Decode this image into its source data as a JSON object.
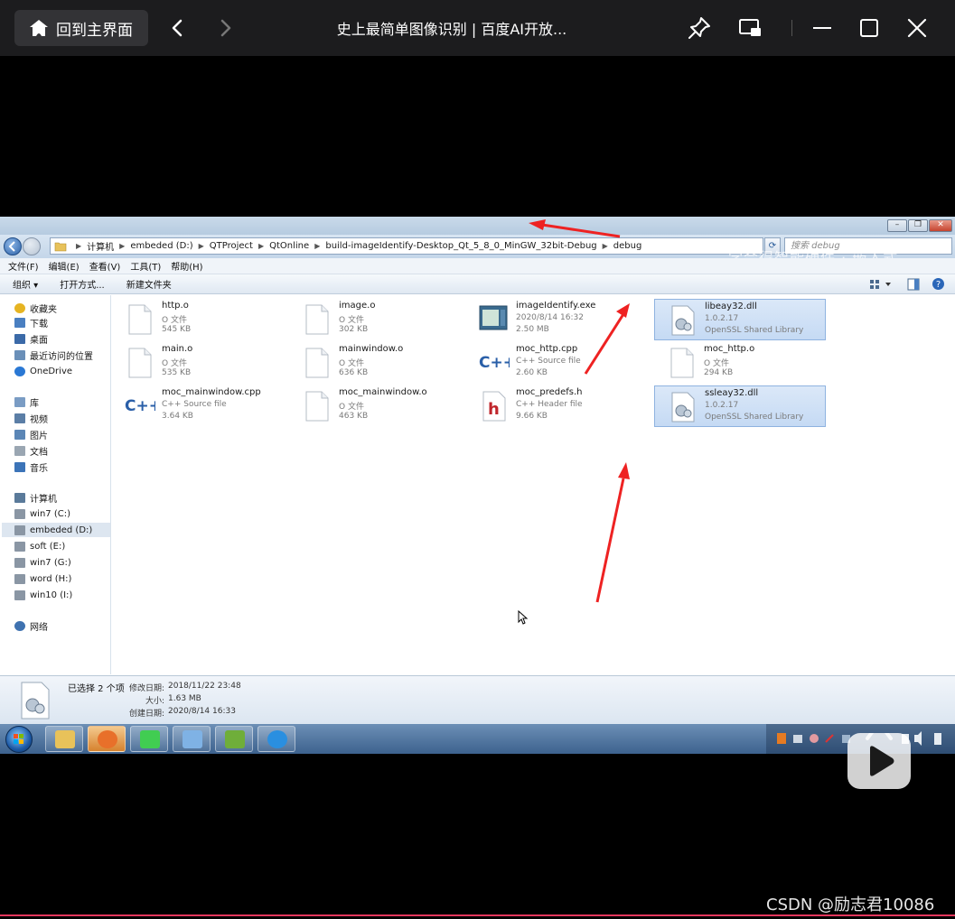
{
  "player": {
    "home_label": "回到主界面",
    "title": "史上最简单图像识别 | 百度AI开放...",
    "progress": 1.0
  },
  "explorer": {
    "breadcrumb": [
      "计算机",
      "embeded (D:)",
      "QTProject",
      "QtOnline",
      "build-imageIdentify-Desktop_Qt_5_8_0_MinGW_32bit-Debug",
      "debug"
    ],
    "search_placeholder": "搜索 debug",
    "watermark": "学会得智能硬件 · 嵌入式",
    "menu": [
      "文件(F)",
      "编辑(E)",
      "查看(V)",
      "工具(T)",
      "帮助(H)"
    ],
    "commands": [
      "组织 ▾",
      "打开方式...",
      "新建文件夹"
    ],
    "nav": [
      {
        "label": "收藏夹",
        "icon": "star-icon",
        "color": "#e6b422"
      },
      {
        "label": "下载",
        "icon": "download-folder-icon",
        "color": "#4a7fc1"
      },
      {
        "label": "桌面",
        "icon": "desktop-icon",
        "color": "#3b6aa8"
      },
      {
        "label": "最近访问的位置",
        "icon": "recent-places-icon",
        "color": "#6a8fb8"
      },
      {
        "label": "OneDrive",
        "icon": "cloud-icon",
        "color": "#2a78d4"
      },
      {
        "label": "库",
        "icon": "library-icon",
        "color": "#7a9cc4"
      },
      {
        "label": "视频",
        "icon": "video-library-icon",
        "color": "#5b7ea6"
      },
      {
        "label": "图片",
        "icon": "pictures-library-icon",
        "color": "#5b86b6"
      },
      {
        "label": "文档",
        "icon": "documents-library-icon",
        "color": "#9aa6b2"
      },
      {
        "label": "音乐",
        "icon": "music-library-icon",
        "color": "#3c74b8"
      },
      {
        "label": "计算机",
        "icon": "computer-icon",
        "color": "#5a7a9a"
      },
      {
        "label": "win7 (C:)",
        "icon": "drive-icon",
        "color": "#8a96a4"
      },
      {
        "label": "embeded (D:)",
        "icon": "drive-icon",
        "color": "#8a96a4",
        "selected": true
      },
      {
        "label": "soft (E:)",
        "icon": "drive-icon",
        "color": "#8a96a4"
      },
      {
        "label": "win7 (G:)",
        "icon": "drive-icon",
        "color": "#8a96a4"
      },
      {
        "label": "word (H:)",
        "icon": "drive-icon",
        "color": "#8a96a4"
      },
      {
        "label": "win10 (I:)",
        "icon": "drive-icon",
        "color": "#8a96a4"
      },
      {
        "label": "网络",
        "icon": "network-icon",
        "color": "#3f72b0"
      }
    ],
    "files": [
      {
        "name": "http.o",
        "type": "O 文件",
        "size": "545 KB",
        "icon": "blank-file-icon"
      },
      {
        "name": "image.o",
        "type": "O 文件",
        "size": "302 KB",
        "icon": "blank-file-icon"
      },
      {
        "name": "imageIdentify.exe",
        "type": "2020/8/14 16:32",
        "size": "2.50 MB",
        "icon": "exe-icon"
      },
      {
        "name": "libeay32.dll",
        "type": "1.0.2.17",
        "size": "OpenSSL Shared Library",
        "icon": "dll-icon",
        "selected": true
      },
      {
        "name": "main.o",
        "type": "O 文件",
        "size": "535 KB",
        "icon": "blank-file-icon"
      },
      {
        "name": "mainwindow.o",
        "type": "O 文件",
        "size": "636 KB",
        "icon": "blank-file-icon"
      },
      {
        "name": "moc_http.cpp",
        "type": "C++ Source file",
        "size": "2.60 KB",
        "icon": "cpp-icon"
      },
      {
        "name": "moc_http.o",
        "type": "O 文件",
        "size": "294 KB",
        "icon": "blank-file-icon"
      },
      {
        "name": "moc_mainwindow.cpp",
        "type": "C++ Source file",
        "size": "3.64 KB",
        "icon": "cpp-icon"
      },
      {
        "name": "moc_mainwindow.o",
        "type": "O 文件",
        "size": "463 KB",
        "icon": "blank-file-icon"
      },
      {
        "name": "moc_predefs.h",
        "type": "C++ Header file",
        "size": "9.66 KB",
        "icon": "header-icon"
      },
      {
        "name": "ssleay32.dll",
        "type": "1.0.2.17",
        "size": "OpenSSL Shared Library",
        "icon": "dll-icon",
        "selected": true
      }
    ],
    "details": {
      "count": "已选择 2 个项",
      "modified_label": "修改日期:",
      "modified": "2018/11/22 23:48",
      "size_label": "大小:",
      "size": "1.63 MB",
      "created_label": "创建日期:",
      "created": "2020/8/14 16:33"
    }
  },
  "taskbar": {
    "apps": [
      {
        "icon": "file-explorer-icon",
        "color": "#e8c25a"
      },
      {
        "icon": "firefox-icon",
        "color": "#e8702a",
        "active": true
      },
      {
        "icon": "qt-creator-icon",
        "color": "#41cd52"
      },
      {
        "icon": "paint-icon",
        "color": "#7fb2e5"
      },
      {
        "icon": "notepad-icon",
        "color": "#6fae3a"
      },
      {
        "icon": "internet-explorer-icon",
        "color": "#2a8fe0"
      }
    ]
  },
  "accent": "#e8365d",
  "csdn_watermark": "CSDN @励志君10086"
}
